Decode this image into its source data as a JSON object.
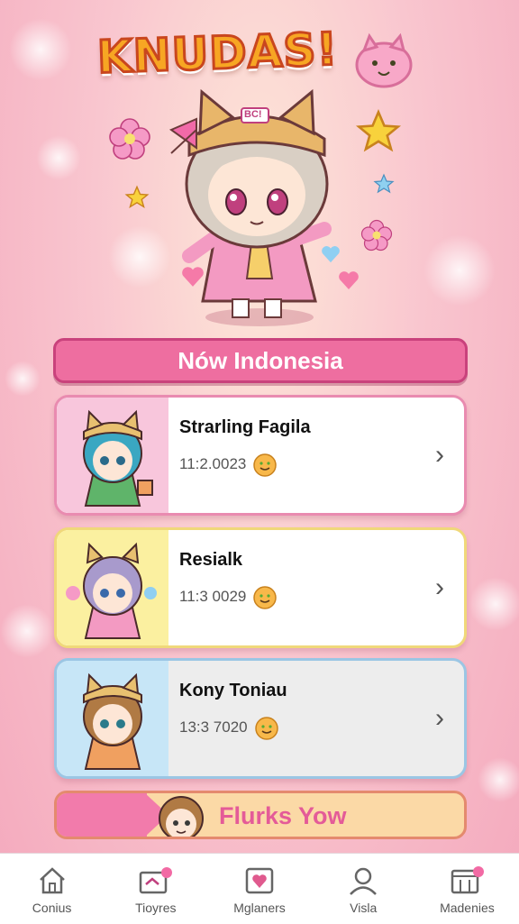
{
  "app": {
    "title": "KNUDAS!"
  },
  "hero": {
    "badge_text": "BC!"
  },
  "section": {
    "header": "Nów Indonesia"
  },
  "cards": [
    {
      "name": "Strarling Fagila",
      "number": "11:2.0023",
      "bg": "#f8c6dc"
    },
    {
      "name": "Resialk",
      "number": "11:3 0029",
      "bg": "#fbf0a0"
    },
    {
      "name": "Kony Toniau",
      "number": "13:3 7020",
      "bg": "#c7e6f7"
    }
  ],
  "cta": {
    "label": "Flurks Yow"
  },
  "nav": [
    {
      "label": "Conius",
      "icon": "home-icon"
    },
    {
      "label": "Tioyres",
      "icon": "ticket-icon"
    },
    {
      "label": "Mglaners",
      "icon": "gift-box-icon"
    },
    {
      "label": "Visla",
      "icon": "person-icon"
    },
    {
      "label": "Madenies",
      "icon": "calendar-icon"
    }
  ],
  "colors": {
    "accent": "#ee6ea0",
    "header_border": "#c9427c",
    "cta_bg": "#fbd9a6"
  }
}
